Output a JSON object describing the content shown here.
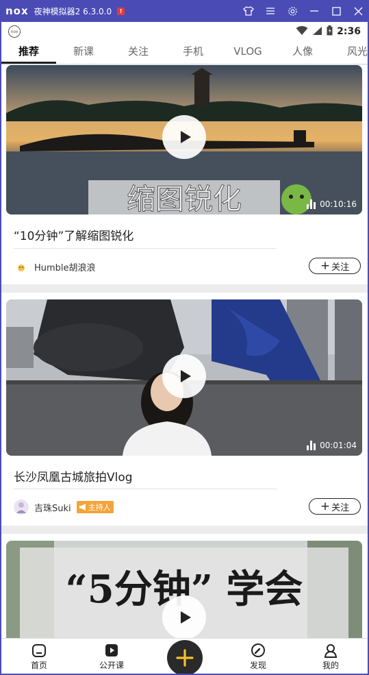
{
  "emulator": {
    "logo": "nox",
    "title": "夜神模拟器2 6.3.0.0",
    "alert_badge": "!"
  },
  "statusbar": {
    "time": "2:36"
  },
  "tabs": [
    {
      "label": "推荐",
      "active": true
    },
    {
      "label": "新课"
    },
    {
      "label": "关注"
    },
    {
      "label": "手机"
    },
    {
      "label": "VLOG"
    },
    {
      "label": "人像"
    },
    {
      "label": "风光"
    }
  ],
  "videos": [
    {
      "title": "“10分钟”了解缩图锐化",
      "duration": "00:10:16",
      "thumb_caption": "缩图锐化",
      "author": "Humble胡浪浪",
      "follow_label": "关注"
    },
    {
      "title": "长沙凤凰古城旅拍Vlog",
      "duration": "00:01:04",
      "author": "吉珠Suki",
      "host_badge": "主持人",
      "follow_label": "关注"
    },
    {
      "thumb_caption": "“5分钟” 学会"
    }
  ],
  "bottomnav": [
    {
      "label": "首页",
      "icon": "home-icon"
    },
    {
      "label": "公开课",
      "icon": "play-square-icon"
    },
    {
      "label": "发现",
      "icon": "compass-icon"
    },
    {
      "label": "我的",
      "icon": "user-icon"
    }
  ],
  "fab_icon": "plus-icon",
  "colors": {
    "emulator_bar": "#4b4bb5",
    "fab_plus": "#f5c12e",
    "host_badge": "#f3a43a"
  }
}
